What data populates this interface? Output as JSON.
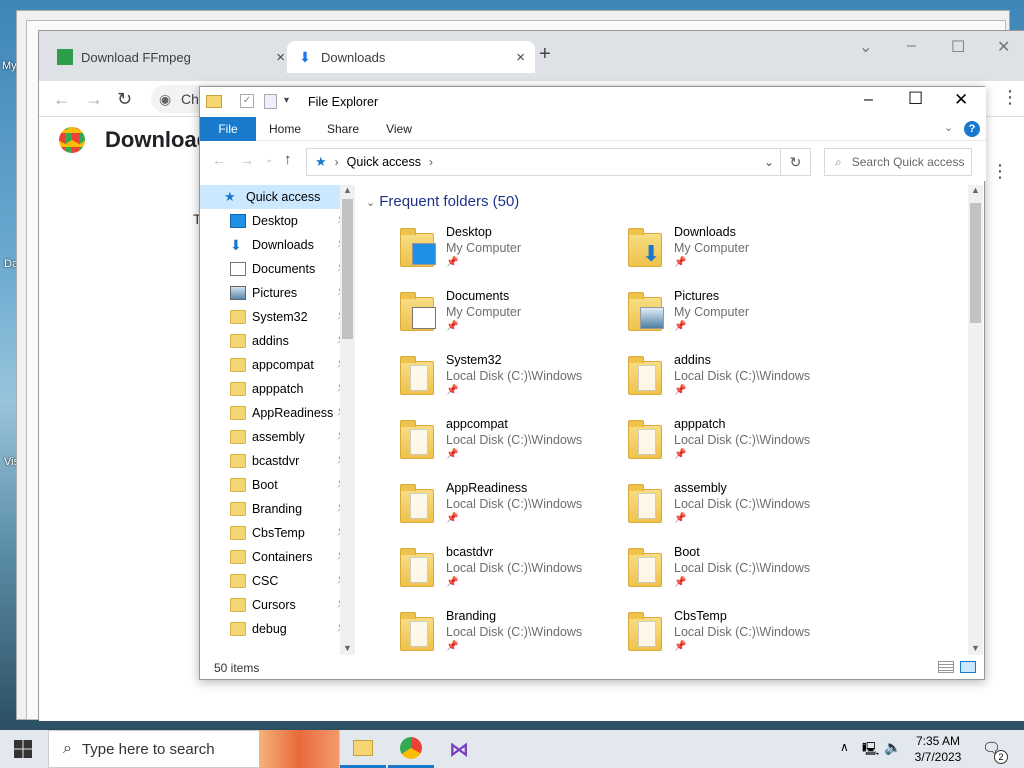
{
  "desktop": {
    "text1": "My",
    "text2": "Da",
    "text3": "Vis"
  },
  "chrome": {
    "tabs": [
      {
        "label": "Download FFmpeg",
        "close": "×"
      },
      {
        "label": "Downloads",
        "close": "×"
      }
    ],
    "new_tab": "+",
    "omnibox_text": "Chr",
    "page_title": "Download",
    "side_letter": "T",
    "win_min": "–",
    "win_max": "☐",
    "win_close": "✕",
    "menu": "⋮"
  },
  "explorer": {
    "title": "File Explorer",
    "ribbon": [
      "File",
      "Home",
      "Share",
      "View"
    ],
    "address": {
      "location": "Quick access",
      "sep": "›"
    },
    "search_placeholder": "Search Quick access",
    "nav_header": "Quick access",
    "nav_items": [
      {
        "label": "Desktop",
        "icon": "desktop-icon"
      },
      {
        "label": "Downloads",
        "icon": "downloads-icon"
      },
      {
        "label": "Documents",
        "icon": "documents-icon"
      },
      {
        "label": "Pictures",
        "icon": "pictures-icon"
      },
      {
        "label": "System32",
        "icon": "folder-icon"
      },
      {
        "label": "addins",
        "icon": "folder-icon"
      },
      {
        "label": "appcompat",
        "icon": "folder-icon"
      },
      {
        "label": "apppatch",
        "icon": "folder-icon"
      },
      {
        "label": "AppReadiness",
        "icon": "folder-icon"
      },
      {
        "label": "assembly",
        "icon": "folder-icon"
      },
      {
        "label": "bcastdvr",
        "icon": "folder-icon"
      },
      {
        "label": "Boot",
        "icon": "folder-icon"
      },
      {
        "label": "Branding",
        "icon": "folder-icon"
      },
      {
        "label": "CbsTemp",
        "icon": "folder-icon"
      },
      {
        "label": "Containers",
        "icon": "folder-icon"
      },
      {
        "label": "CSC",
        "icon": "folder-icon"
      },
      {
        "label": "Cursors",
        "icon": "folder-icon"
      },
      {
        "label": "debug",
        "icon": "folder-icon"
      }
    ],
    "group_title": "Frequent folders (50)",
    "folders": [
      {
        "name": "Desktop",
        "location": "My Computer"
      },
      {
        "name": "Downloads",
        "location": "My Computer"
      },
      {
        "name": "Documents",
        "location": "My Computer"
      },
      {
        "name": "Pictures",
        "location": "My Computer"
      },
      {
        "name": "System32",
        "location": "Local Disk (C:)\\Windows"
      },
      {
        "name": "addins",
        "location": "Local Disk (C:)\\Windows"
      },
      {
        "name": "appcompat",
        "location": "Local Disk (C:)\\Windows"
      },
      {
        "name": "apppatch",
        "location": "Local Disk (C:)\\Windows"
      },
      {
        "name": "AppReadiness",
        "location": "Local Disk (C:)\\Windows"
      },
      {
        "name": "assembly",
        "location": "Local Disk (C:)\\Windows"
      },
      {
        "name": "bcastdvr",
        "location": "Local Disk (C:)\\Windows"
      },
      {
        "name": "Boot",
        "location": "Local Disk (C:)\\Windows"
      },
      {
        "name": "Branding",
        "location": "Local Disk (C:)\\Windows"
      },
      {
        "name": "CbsTemp",
        "location": "Local Disk (C:)\\Windows"
      }
    ],
    "status": "50 items"
  },
  "taskbar": {
    "search_placeholder": "Type here to search",
    "time": "7:35 AM",
    "date": "3/7/2023",
    "notif_count": "2"
  }
}
